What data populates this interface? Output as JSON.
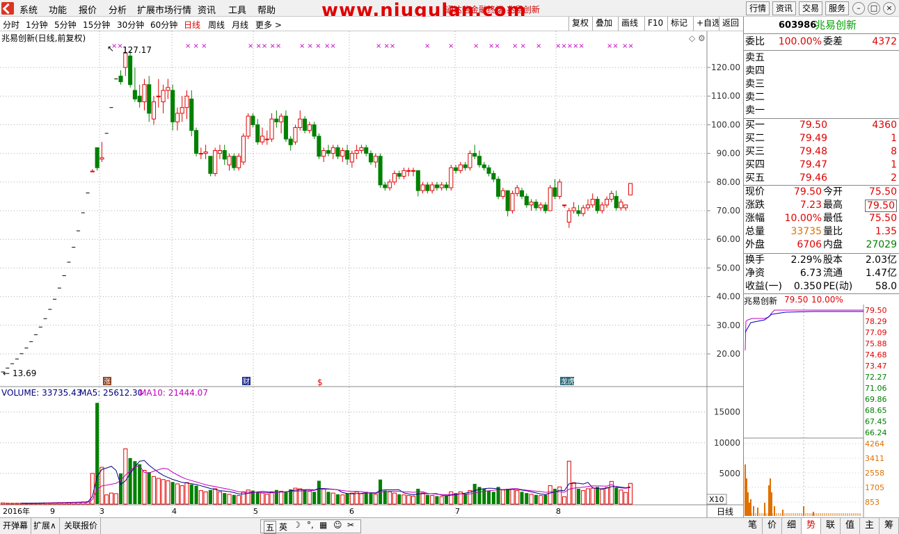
{
  "menubar": {
    "items": [
      "系统",
      "功能",
      "报价",
      "分析",
      "扩展市场行情",
      "资讯",
      "工具",
      "帮助"
    ],
    "watermark": "www.niugulan.com",
    "title_hint": "通达信金融终端  兆易创新",
    "right_buttons": [
      "行情",
      "资讯",
      "交易",
      "服务"
    ]
  },
  "periods": {
    "items": [
      "分时",
      "1分钟",
      "5分钟",
      "15分钟",
      "30分钟",
      "60分钟",
      "日线",
      "周线",
      "月线",
      "更多 >"
    ],
    "active": "日线",
    "tools": [
      "复权",
      "叠加",
      "画线",
      "F10",
      "标记",
      "+自选",
      "返回"
    ]
  },
  "chart": {
    "title": "兆易创新(日线,前复权)",
    "high_label": "127.17",
    "low_label": "13.69",
    "price_ticks": [
      "120.00",
      "110.00",
      "100.00",
      "90.00",
      "80.00",
      "70.00",
      "60.00",
      "50.00",
      "40.00",
      "30.00",
      "20.00"
    ],
    "volume_legend": {
      "volume": "VOLUME: 33735.43",
      "ma5": "MA5: 25612.30",
      "ma10": "MA10: 21444.07"
    },
    "volume_ticks": [
      "15000",
      "10000",
      "5000"
    ],
    "volume_unit": "X10",
    "date_labels": [
      "2016年",
      "9",
      "3",
      "4",
      "5",
      "6",
      "7",
      "8"
    ],
    "events": [
      "涨",
      "财",
      "$",
      "龙虎"
    ],
    "period_label": "日线"
  },
  "chart_data": {
    "type": "candlestick",
    "ylim": [
      10,
      130
    ],
    "vol_max": 17000,
    "candles": [
      [
        13.7,
        13.7,
        13.7,
        13.7,
        200
      ],
      [
        15.07,
        15.07,
        15.07,
        15.07,
        150
      ],
      [
        16.58,
        16.58,
        16.58,
        16.58,
        130
      ],
      [
        18.24,
        18.24,
        18.24,
        18.24,
        140
      ],
      [
        20.06,
        20.06,
        20.06,
        20.06,
        150
      ],
      [
        22.07,
        22.07,
        22.07,
        22.07,
        140
      ],
      [
        24.28,
        24.28,
        24.28,
        24.28,
        160
      ],
      [
        26.71,
        26.71,
        26.71,
        26.71,
        170
      ],
      [
        29.38,
        29.38,
        29.38,
        29.38,
        180
      ],
      [
        32.32,
        32.32,
        32.32,
        32.32,
        200
      ],
      [
        35.55,
        35.55,
        35.55,
        35.55,
        210
      ],
      [
        39.1,
        39.1,
        39.1,
        39.1,
        230
      ],
      [
        43.0,
        43.0,
        43.0,
        43.0,
        250
      ],
      [
        47.3,
        47.3,
        47.3,
        47.3,
        260
      ],
      [
        52.03,
        52.03,
        52.03,
        52.03,
        280
      ],
      [
        57.23,
        57.23,
        57.23,
        57.23,
        300
      ],
      [
        62.96,
        62.96,
        62.96,
        62.96,
        320
      ],
      [
        69.26,
        69.26,
        69.26,
        69.26,
        350
      ],
      [
        76.18,
        76.18,
        76.18,
        76.18,
        400
      ],
      [
        83.8,
        84.5,
        83.8,
        83.8,
        5000
      ],
      [
        92.0,
        92.0,
        84.0,
        85.0,
        16500
      ],
      [
        88.0,
        94.0,
        87.0,
        88.5,
        6000
      ],
      [
        97.0,
        97.0,
        97.0,
        97.0,
        1500
      ],
      [
        106.0,
        106.0,
        106.0,
        106.0,
        1800
      ],
      [
        116.0,
        116.0,
        116.0,
        116.0,
        1700
      ],
      [
        117.0,
        119.0,
        114.0,
        115.0,
        5000
      ],
      [
        120.0,
        127.17,
        117.0,
        125.0,
        9000
      ],
      [
        124.0,
        126.0,
        113.0,
        114.0,
        7500
      ],
      [
        112.0,
        120.0,
        108.0,
        109.0,
        7000
      ],
      [
        110.0,
        114.0,
        106.0,
        108.0,
        6500
      ],
      [
        108.0,
        116.0,
        105.0,
        114.0,
        5500
      ],
      [
        114.0,
        117.0,
        101.0,
        104.0,
        5200
      ],
      [
        102.0,
        110.0,
        100.0,
        108.0,
        4500
      ],
      [
        110.0,
        116.0,
        106.0,
        110.0,
        4200
      ],
      [
        108.0,
        114.0,
        104.0,
        112.0,
        4000
      ],
      [
        112.0,
        116.0,
        109.0,
        113.0,
        3800
      ],
      [
        112.0,
        114.0,
        98.0,
        101.0,
        3600
      ],
      [
        101.0,
        106.0,
        98.0,
        104.0,
        3300
      ],
      [
        104.0,
        110.0,
        101.0,
        106.0,
        3000
      ],
      [
        106.0,
        112.0,
        102.0,
        110.0,
        3500
      ],
      [
        109.0,
        112.0,
        96.0,
        98.0,
        3200
      ],
      [
        98.0,
        99.0,
        89.0,
        90.0,
        3000
      ],
      [
        90.0,
        92.0,
        88.0,
        90.0,
        2200
      ],
      [
        90.0,
        93.0,
        88.0,
        90.5,
        2000
      ],
      [
        89.0,
        89.0,
        82.0,
        83.0,
        2300
      ],
      [
        83.0,
        92.0,
        82.0,
        91.0,
        2500
      ],
      [
        90.0,
        93.0,
        88.0,
        91.0,
        2000
      ],
      [
        91.0,
        93.0,
        86.0,
        88.0,
        1800
      ],
      [
        86.0,
        90.0,
        84.0,
        89.0,
        1600
      ],
      [
        89.0,
        90.0,
        84.0,
        85.0,
        1500
      ],
      [
        85.0,
        90.0,
        84.0,
        89.0,
        1400
      ],
      [
        87.0,
        97.0,
        86.0,
        96.0,
        2000
      ],
      [
        96.0,
        104.0,
        95.0,
        103.0,
        2300
      ],
      [
        103.0,
        104.0,
        99.0,
        100.0,
        2200
      ],
      [
        100.0,
        102.0,
        93.0,
        94.0,
        2000
      ],
      [
        94.0,
        99.0,
        93.0,
        96.0,
        1800
      ],
      [
        95.0,
        98.0,
        93.0,
        95.0,
        1600
      ],
      [
        95.0,
        104.0,
        94.0,
        102.0,
        2000
      ],
      [
        102.0,
        105.0,
        99.0,
        101.0,
        2300
      ],
      [
        101.0,
        104.0,
        97.0,
        103.0,
        2100
      ],
      [
        103.0,
        105.0,
        94.0,
        95.0,
        2000
      ],
      [
        95.0,
        96.0,
        91.0,
        93.0,
        2400
      ],
      [
        94.0,
        100.0,
        93.0,
        99.0,
        2600
      ],
      [
        99.0,
        105.0,
        98.0,
        102.0,
        2500
      ],
      [
        102.0,
        103.0,
        97.0,
        98.0,
        2300
      ],
      [
        98.0,
        101.0,
        97.0,
        100.0,
        2100
      ],
      [
        100.0,
        101.0,
        95.0,
        96.0,
        2000
      ],
      [
        96.0,
        97.0,
        88.0,
        89.0,
        3800
      ],
      [
        89.0,
        92.0,
        87.0,
        91.0,
        2500
      ],
      [
        91.0,
        93.0,
        89.0,
        90.0,
        2000
      ],
      [
        90.0,
        93.0,
        88.0,
        92.0,
        1800
      ],
      [
        92.0,
        93.0,
        88.0,
        89.0,
        1600
      ],
      [
        89.0,
        92.0,
        87.0,
        91.0,
        1500
      ],
      [
        91.0,
        93.0,
        86.0,
        88.0,
        1700
      ],
      [
        87.0,
        91.0,
        85.0,
        90.0,
        1800
      ],
      [
        90.0,
        93.0,
        88.0,
        91.0,
        2000
      ],
      [
        91.0,
        93.0,
        90.0,
        92.0,
        1700
      ],
      [
        92.0,
        93.0,
        89.0,
        90.0,
        2000
      ],
      [
        90.0,
        91.0,
        86.0,
        87.0,
        1800
      ],
      [
        87.0,
        90.0,
        85.0,
        89.0,
        1600
      ],
      [
        89.0,
        90.0,
        78.0,
        79.0,
        4000
      ],
      [
        79.0,
        80.0,
        77.0,
        78.0,
        2200
      ],
      [
        78.0,
        81.0,
        77.0,
        80.0,
        2000
      ],
      [
        80.0,
        84.0,
        79.0,
        83.0,
        1800
      ],
      [
        83.0,
        84.0,
        81.0,
        82.0,
        1600
      ],
      [
        82.0,
        85.0,
        81.0,
        84.0,
        1500
      ],
      [
        84.0,
        85.0,
        82.0,
        84.0,
        1400
      ],
      [
        84.0,
        85.0,
        82.0,
        84.0,
        1300
      ],
      [
        84.0,
        84.0,
        75.0,
        77.0,
        2500
      ],
      [
        77.0,
        80.0,
        76.0,
        79.0,
        1800
      ],
      [
        79.0,
        80.0,
        76.0,
        77.0,
        1500
      ],
      [
        77.0,
        80.0,
        76.0,
        79.0,
        1400
      ],
      [
        79.0,
        80.0,
        77.0,
        78.0,
        1300
      ],
      [
        78.0,
        80.0,
        77.0,
        79.0,
        1200
      ],
      [
        79.0,
        80.0,
        77.0,
        78.0,
        1400
      ],
      [
        78.0,
        86.0,
        77.0,
        85.0,
        2000
      ],
      [
        85.0,
        86.0,
        83.0,
        84.0,
        1800
      ],
      [
        84.0,
        87.0,
        83.0,
        86.0,
        2000
      ],
      [
        86.0,
        87.0,
        84.0,
        85.0,
        1700
      ],
      [
        85.0,
        91.0,
        84.0,
        90.0,
        2200
      ],
      [
        90.0,
        93.0,
        88.0,
        89.0,
        3300
      ],
      [
        89.0,
        91.0,
        85.0,
        86.0,
        2800
      ],
      [
        86.0,
        87.0,
        84.0,
        85.0,
        2500
      ],
      [
        85.0,
        86.0,
        82.0,
        83.0,
        2200
      ],
      [
        83.0,
        84.0,
        80.0,
        81.0,
        2000
      ],
      [
        81.0,
        82.0,
        74.0,
        75.0,
        2800
      ],
      [
        75.0,
        78.0,
        74.0,
        77.0,
        2300
      ],
      [
        77.0,
        77.0,
        68.0,
        70.0,
        2500
      ],
      [
        70.0,
        77.0,
        69.0,
        76.0,
        2400
      ],
      [
        76.0,
        79.0,
        75.0,
        78.0,
        2200
      ],
      [
        77.0,
        78.0,
        74.0,
        75.0,
        2000
      ],
      [
        75.0,
        76.0,
        71.0,
        72.0,
        1800
      ],
      [
        72.0,
        74.0,
        70.0,
        73.0,
        1600
      ],
      [
        73.0,
        74.0,
        70.0,
        71.0,
        1500
      ],
      [
        71.0,
        73.0,
        70.0,
        72.0,
        1400
      ],
      [
        72.0,
        73.0,
        69.0,
        70.0,
        1500
      ],
      [
        70.0,
        79.0,
        70.0,
        78.0,
        3000
      ],
      [
        78.0,
        81.0,
        74.0,
        75.0,
        2500
      ],
      [
        75.0,
        81.0,
        74.0,
        80.0,
        2800
      ],
      [
        72.0,
        72.0,
        71.0,
        72.0,
        1200
      ],
      [
        66.0,
        71.0,
        64.0,
        70.0,
        7000
      ],
      [
        70.0,
        73.0,
        69.0,
        71.0,
        3500
      ],
      [
        70.0,
        72.0,
        68.0,
        69.0,
        2500
      ],
      [
        69.0,
        72.0,
        68.0,
        71.0,
        2200
      ],
      [
        71.0,
        74.0,
        70.0,
        72.0,
        2500
      ],
      [
        72.0,
        76.0,
        71.0,
        74.0,
        2600
      ],
      [
        74.0,
        75.0,
        69.0,
        70.0,
        2800
      ],
      [
        70.0,
        73.0,
        69.0,
        72.0,
        2400
      ],
      [
        72.0,
        75.0,
        71.0,
        74.0,
        2700
      ],
      [
        74.0,
        77.0,
        73.0,
        76.0,
        3700
      ],
      [
        75.0,
        77.0,
        70.0,
        71.0,
        2700
      ],
      [
        71.0,
        74.0,
        70.0,
        73.0,
        2300
      ],
      [
        71.0,
        72.0,
        70.0,
        72.0,
        1900
      ],
      [
        75.5,
        79.5,
        75.5,
        79.5,
        3373
      ]
    ]
  },
  "quote": {
    "code": "603986",
    "name": "兆易创新",
    "weibi": {
      "label": "委比",
      "value": "100.00%"
    },
    "weicha": {
      "label": "委差",
      "value": "4372"
    },
    "sell": [
      {
        "label": "卖五",
        "price": "",
        "vol": ""
      },
      {
        "label": "卖四",
        "price": "",
        "vol": ""
      },
      {
        "label": "卖三",
        "price": "",
        "vol": ""
      },
      {
        "label": "卖二",
        "price": "",
        "vol": ""
      },
      {
        "label": "卖一",
        "price": "",
        "vol": ""
      }
    ],
    "buy": [
      {
        "label": "买一",
        "price": "79.50",
        "vol": "4360"
      },
      {
        "label": "买二",
        "price": "79.49",
        "vol": "1"
      },
      {
        "label": "买三",
        "price": "79.48",
        "vol": "8"
      },
      {
        "label": "买四",
        "price": "79.47",
        "vol": "1"
      },
      {
        "label": "买五",
        "price": "79.46",
        "vol": "2"
      }
    ],
    "stats": [
      {
        "l1": "现价",
        "v1": "79.50",
        "l2": "今开",
        "v2": "75.50",
        "c1": "red",
        "c2": "red"
      },
      {
        "l1": "涨跌",
        "v1": "7.23",
        "l2": "最高",
        "v2": "79.50",
        "c1": "red",
        "c2": "red"
      },
      {
        "l1": "涨幅",
        "v1": "10.00%",
        "l2": "最低",
        "v2": "75.50",
        "c1": "red",
        "c2": "red"
      },
      {
        "l1": "总量",
        "v1": "33735",
        "l2": "量比",
        "v2": "1.35",
        "c1": "orange",
        "c2": "red"
      },
      {
        "l1": "外盘",
        "v1": "6706",
        "l2": "内盘",
        "v2": "27029",
        "c1": "red",
        "c2": "green"
      }
    ],
    "fund": [
      {
        "l1": "换手",
        "v1": "2.29%",
        "l2": "股本",
        "v2": "2.03亿"
      },
      {
        "l1": "净资",
        "v1": "6.73",
        "l2": "流通",
        "v2": "1.47亿"
      },
      {
        "l1": "收益(一)",
        "v1": "0.350",
        "l2": "PE(动)",
        "v2": "58.0"
      }
    ],
    "mini": {
      "title": "兆易创新",
      "price": "79.50",
      "pct": "10.00%",
      "price_ticks": [
        "79.50",
        "78.29",
        "77.09",
        "75.88",
        "74.68",
        "73.47",
        "72.27",
        "71.06",
        "69.86",
        "68.65",
        "67.45",
        "66.24"
      ],
      "vol_ticks": [
        "4264",
        "3411",
        "2558",
        "1705",
        "853"
      ]
    }
  },
  "bottom": {
    "tabs": [
      "开弹幕",
      "扩展∧",
      "关联报价"
    ],
    "ime": [
      "五",
      "英"
    ],
    "rtabs": [
      "笔",
      "价",
      "细",
      "势",
      "联",
      "值",
      "主",
      "筹"
    ],
    "active_rtab": "势"
  }
}
